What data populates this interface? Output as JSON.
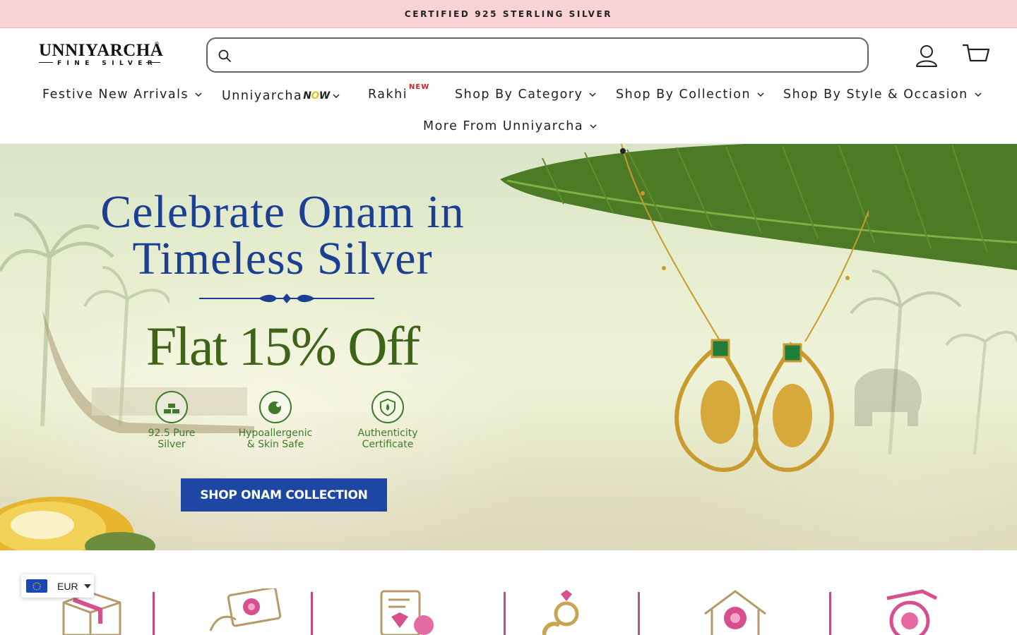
{
  "announcement": {
    "text": "CERTIFIED 925 STERLING SILVER"
  },
  "brand": {
    "name": "UNNIYARCHA",
    "tagline": "FINE SILVER",
    "registered": "®"
  },
  "search": {
    "placeholder": "",
    "value": ""
  },
  "header_icons": {
    "account": "account-icon",
    "cart": "cart-icon"
  },
  "nav": {
    "items": [
      {
        "label": "Festive New Arrivals",
        "has_dropdown": true
      },
      {
        "label": "Unniyarcha",
        "suffix_before": "N",
        "suffix_o": "O",
        "suffix_after": "W",
        "has_dropdown": true
      },
      {
        "label": "Rakhi",
        "badge": "NEW",
        "has_dropdown": false
      },
      {
        "label": "Shop By Category",
        "has_dropdown": true
      },
      {
        "label": "Shop By Collection",
        "has_dropdown": true
      },
      {
        "label": "Shop By Style & Occasion",
        "has_dropdown": true
      },
      {
        "label": "More From Unniyarcha",
        "has_dropdown": true
      }
    ]
  },
  "hero": {
    "headline_line1": "Celebrate Onam in",
    "headline_line2": "Timeless Silver",
    "offer": "Flat 15% Off",
    "badges": [
      {
        "label": "92.5 Pure\nSilver",
        "icon": "silver-bars-icon"
      },
      {
        "label": "Hypoallergenic\n& Skin Safe",
        "icon": "skin-safe-icon"
      },
      {
        "label": "Authenticity\nCertificate",
        "icon": "shield-certificate-icon"
      }
    ],
    "cta": "SHOP ONAM COLLECTION"
  },
  "categories": {
    "icons": [
      "gift-box-icon",
      "gift-card-icon",
      "certificate-gem-icon",
      "ring-icon",
      "home-lotus-icon",
      "travel-pouch-icon"
    ]
  },
  "currency": {
    "code": "EUR",
    "flag": "eu-flag-icon"
  },
  "colors": {
    "announcement_bg": "#f9d2d6",
    "headline_blue": "#1c3f93",
    "offer_green": "#3f6417",
    "badge_green": "#3f7b2a",
    "cta_blue": "#1d47a3",
    "new_badge_red": "#d61f26",
    "category_separator": "#c54b86"
  }
}
